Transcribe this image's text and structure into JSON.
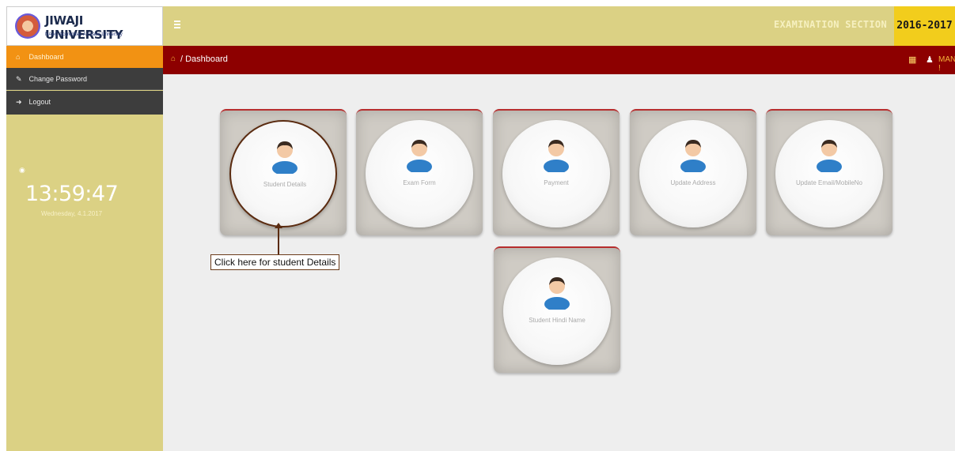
{
  "header": {
    "logo_title": "JIWAJI UNIVERSITY",
    "logo_subtitle": "NAAC Accredited A Grade University",
    "exam_section": "EXAMINATION SECTION",
    "year": "2016-2017"
  },
  "sidebar": {
    "items": [
      {
        "label": "Dashboard",
        "icon": "home-icon"
      },
      {
        "label": "Change Password",
        "icon": "edit-icon"
      },
      {
        "label": "Logout",
        "icon": "logout-icon"
      }
    ],
    "clock_time": "13:59:47",
    "clock_date": "Wednesday, 4.1.2017"
  },
  "breadcrumb": {
    "home_icon": "home-icon",
    "current": "/ Dashboard",
    "user_name": "MANISH !"
  },
  "tiles": [
    {
      "label": "Student Details"
    },
    {
      "label": "Exam Form"
    },
    {
      "label": "Payment"
    },
    {
      "label": "Update Address"
    },
    {
      "label": "Update Email/MobileNo"
    },
    {
      "label": "Student Hindi Name"
    }
  ],
  "callout": "Click here for student Details",
  "colors": {
    "header_bg": "#dbd184",
    "breadcrumb_bg": "#8d0000",
    "active_item": "#f29213",
    "year_badge": "#f2cd1c"
  }
}
